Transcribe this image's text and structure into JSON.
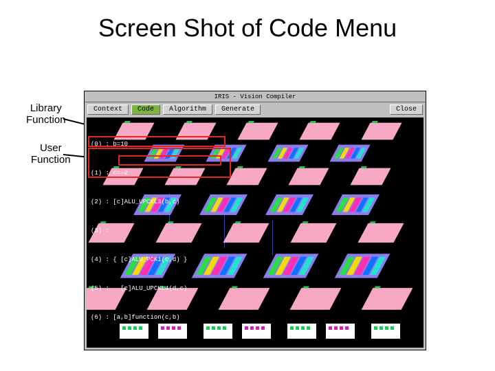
{
  "slide": {
    "title": "Screen Shot of Code Menu",
    "labels": {
      "library": "Library\nFunction",
      "user": "User\nFunction"
    }
  },
  "window": {
    "title": "IRIS - Vision Compiler",
    "menu": {
      "context": "Context",
      "code": "Code",
      "algorithm": "Algorithm",
      "generate": "Generate",
      "close": "Close"
    }
  },
  "code": {
    "lines": [
      "(0) : b=10",
      "(1) : c=-2",
      "(2) : [c]ALU_UPCKL3(b,c)",
      "(3) :",
      "(4) : { [c]ALU_PCK1(c,d) }",
      "(5) :   [c]ALU_UPCKL4(d,c)",
      "(6) : [a,b]function(c,b)"
    ]
  },
  "colors": {
    "highlight": "#e5261f",
    "chip_pink": "#f7a8c4",
    "chip_purple": "#8c7cf0",
    "accent_green": "#18c954"
  }
}
